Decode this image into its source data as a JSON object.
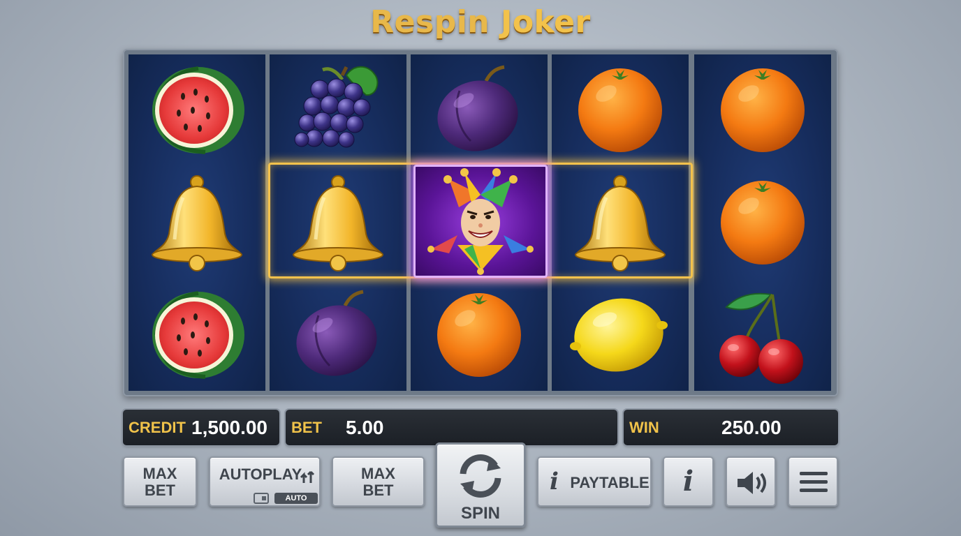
{
  "game": {
    "title_part1": "Respin",
    "title_part2": "Joker"
  },
  "reels": [
    [
      "watermelon",
      "bell",
      "watermelon"
    ],
    [
      "grapes",
      "bell",
      "plum"
    ],
    [
      "plum",
      "joker",
      "orange"
    ],
    [
      "orange",
      "bell",
      "lemon"
    ],
    [
      "orange",
      "orange",
      "cherries"
    ]
  ],
  "win_line": {
    "row": 2,
    "from_reel": 2,
    "to_reel": 4,
    "color": "#f4c24c"
  },
  "status": {
    "credit_label": "CREDIT",
    "credit_value": "1,500.00",
    "bet_label": "BET",
    "bet_value": "5.00",
    "win_label": "WIN",
    "win_value": "250.00"
  },
  "controls": {
    "max_bet_1": [
      "MAX",
      "BET"
    ],
    "autoplay_label": "AUTOPLAY",
    "autoplay_tag": "AUTO",
    "max_bet_2": [
      "MAX",
      "BET"
    ],
    "spin_label": "SPIN",
    "paytable_label": "PAYTABLE",
    "info_glyph": "i",
    "sound_icon": "speaker-icon",
    "menu_icon": "hamburger-menu-icon"
  },
  "colors": {
    "title_gold": "#e8b84a",
    "label_gold": "#f0c24a",
    "reel_blue": "#162c5c",
    "joker_purple": "#5a1497"
  }
}
